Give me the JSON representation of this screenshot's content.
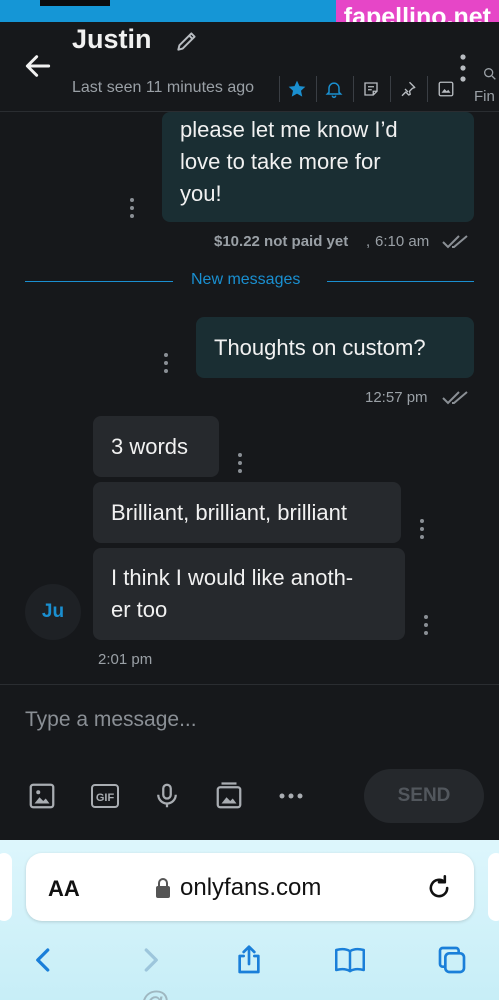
{
  "watermark": "fapellino.net",
  "header": {
    "title": "Justin",
    "last_seen": "Last seen 11 minutes ago",
    "search_label": "Fin"
  },
  "messages": {
    "m1": {
      "line1": "please let me know I’d",
      "line2": "love to take more for",
      "line3": "you!",
      "price_status": "$10.22 not paid yet",
      "time": "6:10 am"
    },
    "divider": "New messages",
    "m2": {
      "text": "Thoughts on custom?",
      "time": "12:57 pm"
    },
    "m3": {
      "text": "3 words"
    },
    "m4": {
      "text": "Brilliant, brilliant, brilliant"
    },
    "m5": {
      "line1": "I think I would like anoth-",
      "line2": "er too"
    },
    "incoming_time": "2:01 pm",
    "avatar_initials": "Ju"
  },
  "composer": {
    "placeholder": "Type a message...",
    "send_label": "SEND"
  },
  "browser": {
    "aa_label": "AA",
    "url": "onlyfans.com",
    "ghost_text": "@ · · · · · · · · · ·"
  },
  "colors": {
    "accent": "#1a8fd0",
    "outgoing_bubble": "#1a2e33",
    "incoming_bubble": "#26292d",
    "background": "#16181b",
    "watermark_bg": "#e646c7"
  }
}
